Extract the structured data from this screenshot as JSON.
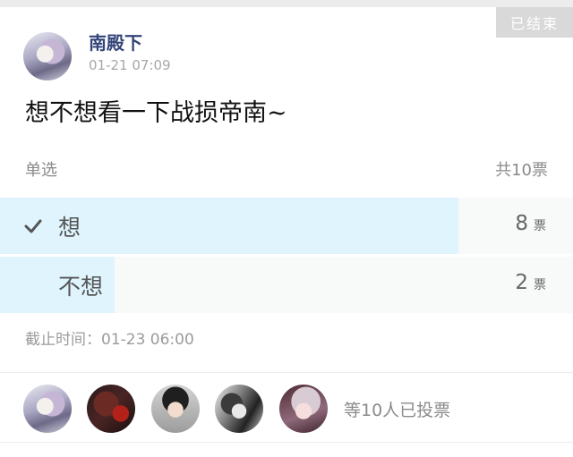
{
  "post": {
    "status_tag": "已结束",
    "author": "南殿下",
    "time": "01-21 07:09",
    "text": "想不想看一下战损帝南~"
  },
  "vote": {
    "type": "单选",
    "total": "共10票",
    "options": [
      {
        "label": "想",
        "count": "8",
        "unit": "票",
        "fraction": 0.8,
        "selected": true
      },
      {
        "label": "不想",
        "count": "2",
        "unit": "票",
        "fraction": 0.2,
        "selected": false
      }
    ],
    "deadline_label": "截止时间：",
    "deadline_value": "01-23 06:00",
    "voters_text": "等10人已投票"
  },
  "colors": {
    "author": "#34457a",
    "fill": "#dff4fd",
    "muted_text": "#8a8a8a",
    "status_tag_bg": "#d9d9d9"
  },
  "icons": {
    "check": "check-icon"
  }
}
